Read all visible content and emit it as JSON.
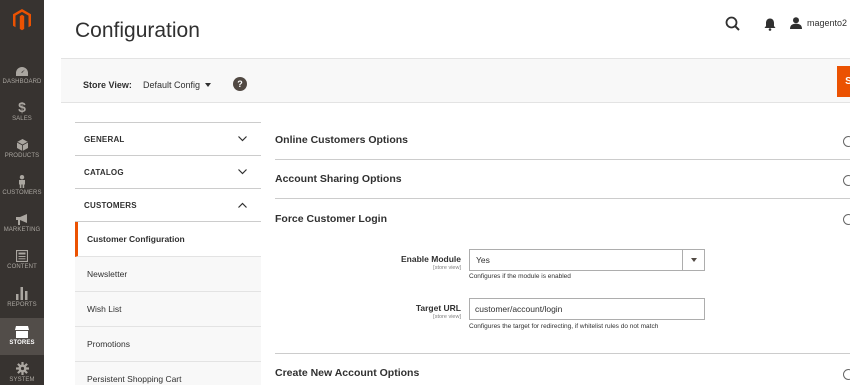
{
  "brand": {
    "accent": "#eb5202",
    "sidebar_bg": "#373330",
    "logo_color": "#eb5202"
  },
  "nav": {
    "items": [
      {
        "label": "DASHBOARD",
        "icon": "dashboard-icon"
      },
      {
        "label": "SALES",
        "icon": "dollar-icon"
      },
      {
        "label": "PRODUCTS",
        "icon": "cube-icon"
      },
      {
        "label": "CUSTOMERS",
        "icon": "person-icon"
      },
      {
        "label": "MARKETING",
        "icon": "megaphone-icon"
      },
      {
        "label": "CONTENT",
        "icon": "layout-icon"
      },
      {
        "label": "REPORTS",
        "icon": "bar-chart-icon"
      },
      {
        "label": "STORES",
        "icon": "store-icon",
        "active": true
      },
      {
        "label": "SYSTEM",
        "icon": "gear-icon"
      }
    ]
  },
  "header": {
    "title": "Configuration",
    "username": "magento2"
  },
  "store_bar": {
    "label": "Store View:",
    "selected": "Default Config",
    "help": "?",
    "save_label": "Save Config"
  },
  "tabs": {
    "general": "GENERAL",
    "catalog": "CATALOG",
    "customers": "CUSTOMERS",
    "customer_items": [
      "Customer Configuration",
      "Newsletter",
      "Wish List",
      "Promotions",
      "Persistent Shopping Cart"
    ]
  },
  "sections": {
    "online_customers": "Online Customers Options",
    "account_sharing": "Account Sharing Options",
    "force_login": "Force Customer Login",
    "create_account": "Create New Account Options"
  },
  "fields": {
    "enable_module": {
      "label": "Enable Module",
      "scope": "[store view]",
      "value": "Yes",
      "note": "Configures if the module is enabled"
    },
    "target_url": {
      "label": "Target URL",
      "scope": "[store view]",
      "value": "customer/account/login",
      "note": "Configures the target for redirecting, if whitelist rules do not match"
    }
  }
}
